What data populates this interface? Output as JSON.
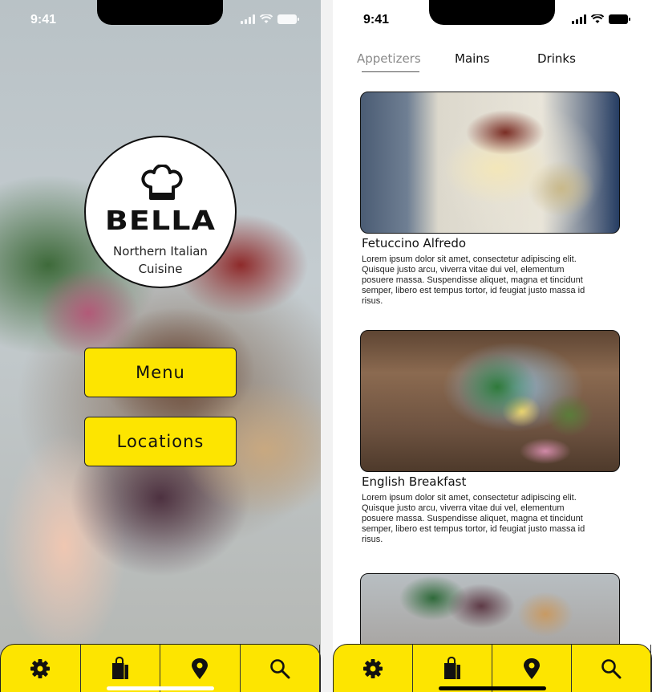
{
  "status_bar": {
    "time": "9:41"
  },
  "home": {
    "brand": "BELLA",
    "tagline_line1": "Northern Italian",
    "tagline_line2": "Cuisine",
    "menu_button": "Menu",
    "locations_button": "Locations"
  },
  "menu": {
    "tabs": [
      "Appetizers",
      "Mains",
      "Drinks"
    ],
    "active_tab": "Appetizers",
    "items": [
      {
        "title": "Fetuccino Alfredo",
        "description": "Lorem ipsum dolor sit amet, consectetur adipiscing elit. Quisque justo arcu, viverra vitae dui vel, elementum posuere massa. Suspendisse aliquet, magna et tincidunt semper, libero est tempus tortor, id feugiat justo massa id risus."
      },
      {
        "title": "English Breakfast",
        "description": "Lorem ipsum dolor sit amet, consectetur adipiscing elit. Quisque justo arcu, viverra vitae dui vel, elementum posuere massa. Suspendisse aliquet, magna et tincidunt semper, libero est tempus tortor, id feugiat justo massa id risus."
      }
    ]
  },
  "tabbar_icons": [
    "gear-icon",
    "shopping-bag-icon",
    "location-pin-icon",
    "search-icon"
  ],
  "colors": {
    "accent": "#fde500",
    "outline": "#222222"
  }
}
